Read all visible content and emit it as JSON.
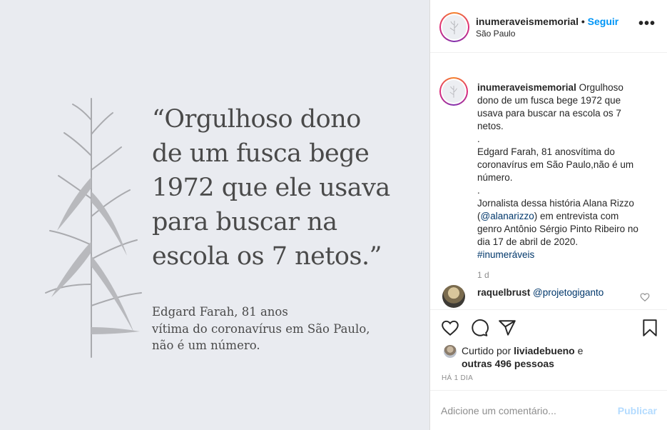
{
  "post_image": {
    "quote_lines": [
      "“Orgulhoso dono",
      "de um fusca bege",
      "1972 que ele usava",
      "para buscar na",
      "escola os 7 netos.”"
    ],
    "attribution_lines": [
      "Edgard Farah, 81 anos",
      "vítima do coronavírus em São Paulo,",
      "não é um número."
    ]
  },
  "header": {
    "username": "inumeraveismemorial",
    "dot": "•",
    "follow_label": "Seguir",
    "location": "São Paulo",
    "more_icon": "more-options-icon",
    "more_label": "•••"
  },
  "caption": {
    "username": "inumeraveismemorial",
    "text_1": " Orgulhoso dono de um fusca bege 1972 que usava para buscar na escola os 7 netos.\n.\nEdgard Farah, 81 anosvítima do coronavírus em São Paulo,não é um número.\n.\nJornalista dessa história Alana Rizzo (",
    "mention": "@alanarizzo",
    "text_2": ") em entrevista com genro Antônio Sérgio Pinto Ribeiro no dia 17 de abril de 2020.\n",
    "hashtag": "#inumeráveis",
    "time": "1 d"
  },
  "reply": {
    "username": "raquelbrust",
    "mention": "@projetogiganto",
    "heart_icon": "heart-outline-icon"
  },
  "actions": {
    "icons": [
      "heart-outline-icon",
      "comment-icon",
      "share-icon",
      "bookmark-icon"
    ]
  },
  "likes": {
    "prefix": "Curtido por ",
    "user": "liviadebueno",
    "suffix": " e",
    "others_label": "outras 496 pessoas"
  },
  "timestamp": "HÁ 1 DIA",
  "comment_box": {
    "placeholder": "Adicione um comentário...",
    "publish_label": "Publicar"
  },
  "colors": {
    "accent": "#0095f6",
    "image_background": "#e9ebf0",
    "publish_disabled": "#b3dbff",
    "mention": "#00376b"
  }
}
